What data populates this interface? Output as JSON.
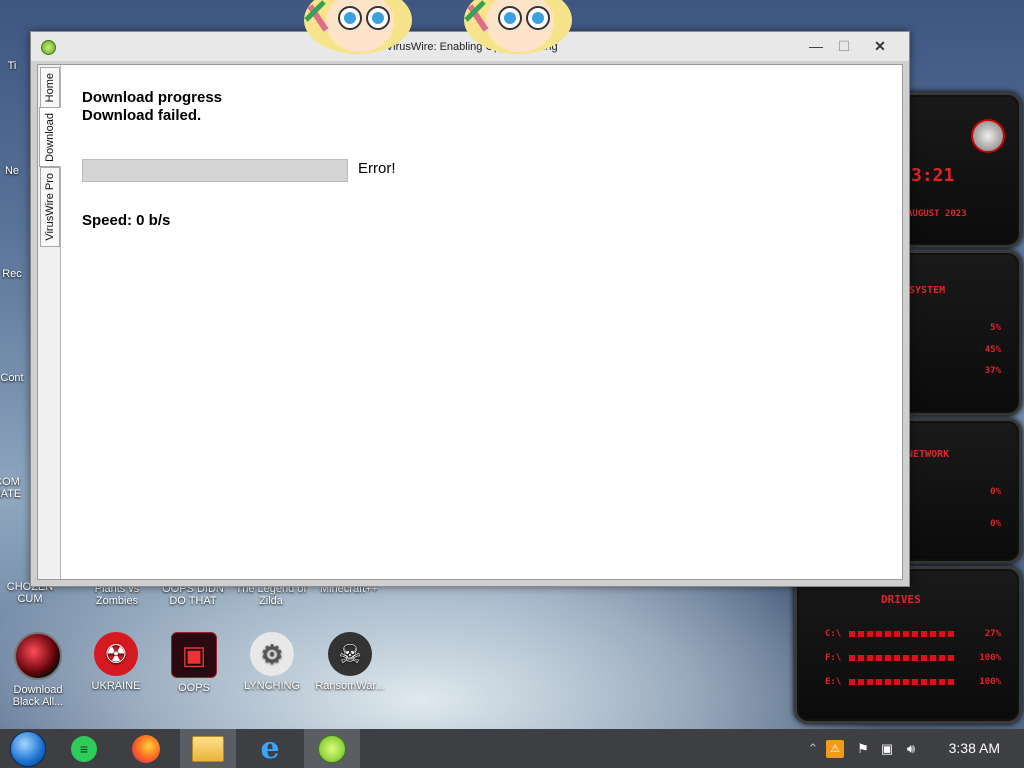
{
  "window": {
    "title": "VirusWire: Enabling Opp... ...aming",
    "minimize_glyph": "—",
    "maximize_glyph": "☐",
    "close_glyph": "✕",
    "tabs": [
      {
        "label": "Home"
      },
      {
        "label": "Download"
      },
      {
        "label": "VirusWire Pro"
      }
    ],
    "active_tab": "Download"
  },
  "download": {
    "heading": "Download progress",
    "status_heading": "Download failed.",
    "progress_percent": 0,
    "status_text": "Error!",
    "speed_text": "Speed: 0 b/s"
  },
  "desktop": {
    "icons": [
      {
        "label": "Download Black All...",
        "icon": "black-sphere-icon"
      },
      {
        "label": "UKRAINE",
        "icon": "radiation-icon"
      },
      {
        "label": "OOPS",
        "icon": "oops-icon"
      },
      {
        "label": "LYNCHING",
        "icon": "noose-icon"
      },
      {
        "label": "RansomWar...",
        "icon": "skull-icon"
      }
    ],
    "partial_labels": [
      {
        "text": "Ti"
      },
      {
        "text": "Ne"
      },
      {
        "text": "Rec"
      },
      {
        "text": "Cont"
      },
      {
        "text": "COM HATE"
      },
      {
        "text": "CHOZEN CUM"
      },
      {
        "text": "Plants vs Zombies"
      },
      {
        "text": "OOPS DIDN DO THAT"
      },
      {
        "text": "The Legend of Zilda"
      },
      {
        "text": "Minecraft++"
      }
    ]
  },
  "gadgets": {
    "clock": {
      "time": "3:21",
      "date": "AUGUST 2023"
    },
    "system": {
      "title": "SYSTEM",
      "values": [
        "5%",
        "45%",
        "37%"
      ]
    },
    "network": {
      "title": "NETWORK",
      "values": [
        "0%",
        "0%"
      ]
    },
    "drives": {
      "title": "DRIVES",
      "rows": [
        {
          "label": "C:\\",
          "value": "27%"
        },
        {
          "label": "F:\\",
          "value": "100%"
        },
        {
          "label": "E:\\",
          "value": "100%"
        }
      ]
    }
  },
  "taskbar": {
    "items": [
      "start-orb-icon",
      "notes-app-icon",
      "firefox-icon",
      "file-explorer-icon",
      "internet-explorer-icon",
      "viruswire-icon"
    ],
    "clock": "3:38 AM"
  }
}
